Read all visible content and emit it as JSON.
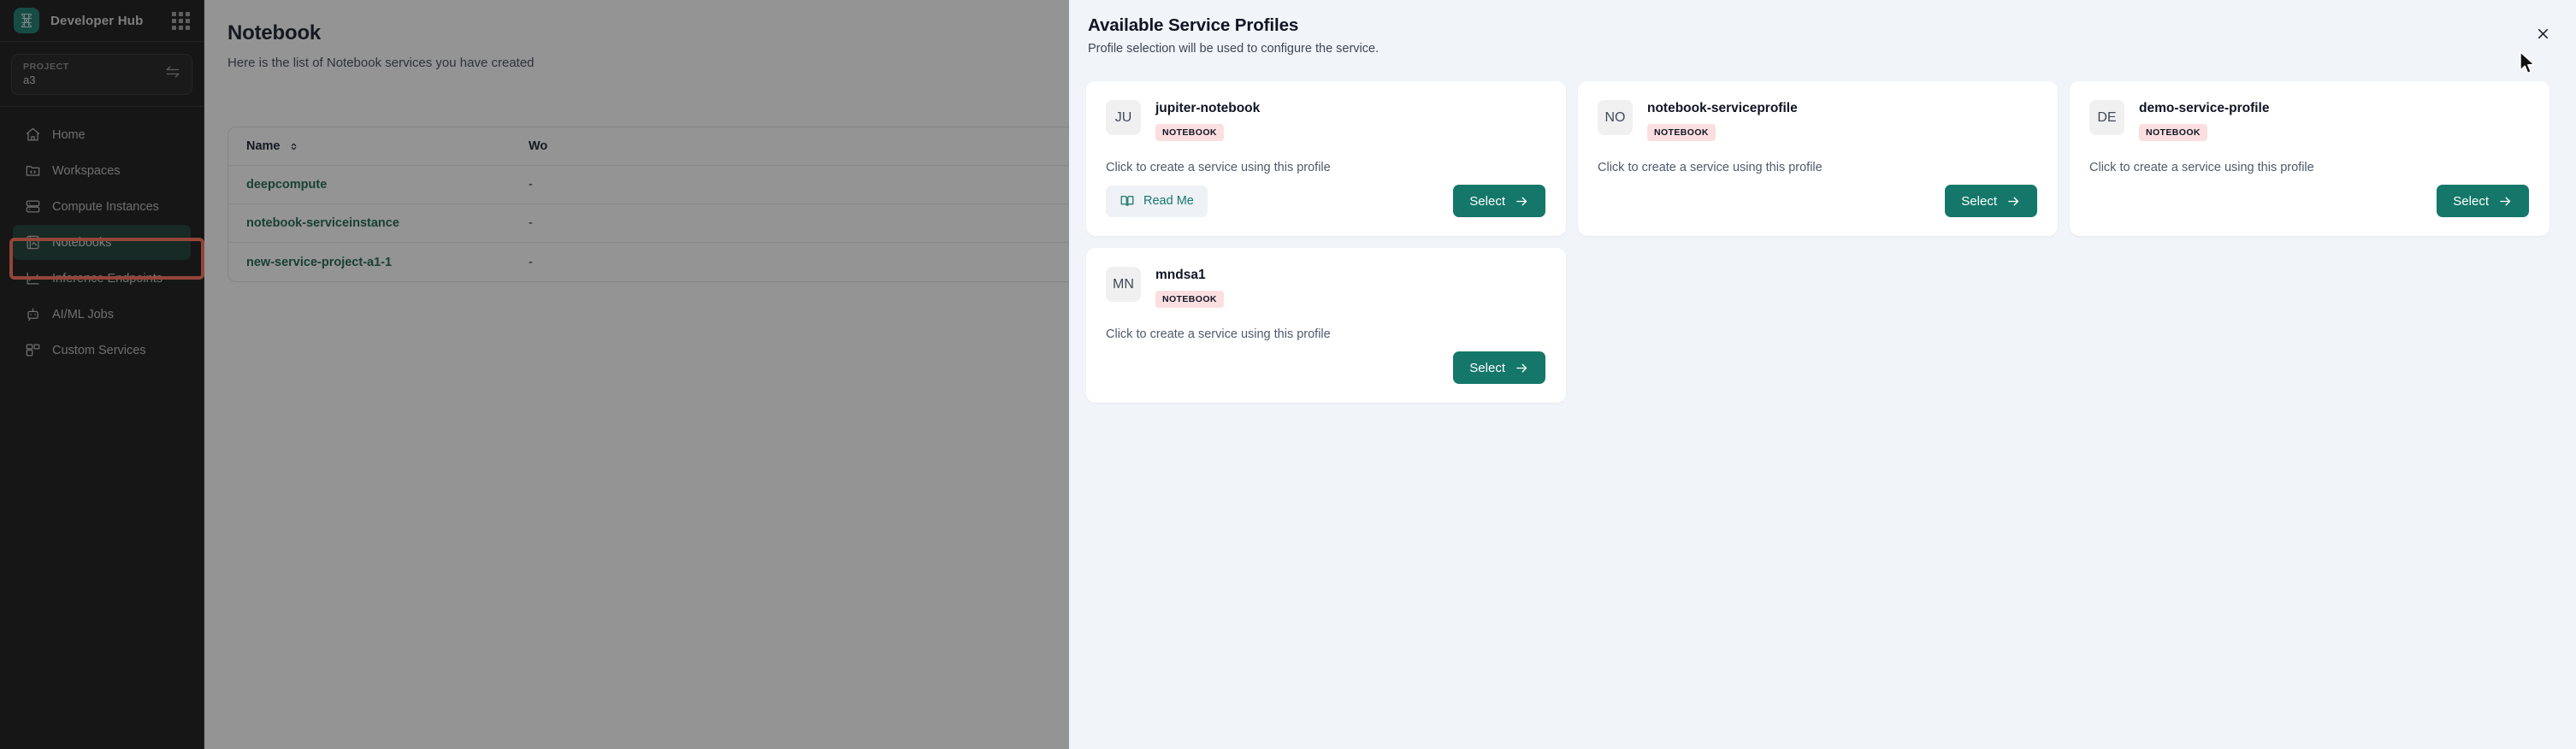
{
  "sidebar": {
    "brand": "Developer Hub",
    "apps_icon": "grid-apps-icon",
    "project": {
      "label": "PROJECT",
      "value": "a3",
      "switch_icon": "swap-arrows-icon"
    },
    "items": [
      {
        "label": "Home",
        "icon": "home-icon",
        "active": false
      },
      {
        "label": "Workspaces",
        "icon": "folder-code-icon",
        "active": false
      },
      {
        "label": "Compute Instances",
        "icon": "server-icon",
        "active": false
      },
      {
        "label": "Notebooks",
        "icon": "notebook-image-icon",
        "active": true
      },
      {
        "label": "Inference Endpoints",
        "icon": "chart-line-icon",
        "active": false
      },
      {
        "label": "AI/ML Jobs",
        "icon": "robot-icon",
        "active": false
      },
      {
        "label": "Custom Services",
        "icon": "blocks-icon",
        "active": false
      }
    ]
  },
  "main": {
    "title": "Notebook",
    "subtitle": "Here is the list of Notebook services you have created",
    "table": {
      "columns": [
        "Name",
        "Wo"
      ],
      "sort_icon": "sort-updown-icon",
      "rows": [
        {
          "name": "deepcompute",
          "wo": "-"
        },
        {
          "name": "notebook-serviceinstance",
          "wo": "-"
        },
        {
          "name": "new-service-project-a1-1",
          "wo": "-"
        }
      ]
    }
  },
  "modal": {
    "title": "Available Service Profiles",
    "subtitle": "Profile selection will be used to configure the service.",
    "close_icon": "close-x-icon",
    "cards": [
      {
        "initials": "JU",
        "name": "jupiter-notebook",
        "tag": "NOTEBOOK",
        "description": "Click to create a service using this profile",
        "readme_label": "Read Me",
        "readme_icon": "book-open-icon",
        "select_label": "Select",
        "select_arrow_icon": "arrow-right-icon",
        "has_readme": true
      },
      {
        "initials": "NO",
        "name": "notebook-serviceprofile",
        "tag": "NOTEBOOK",
        "description": "Click to create a service using this profile",
        "select_label": "Select",
        "select_arrow_icon": "arrow-right-icon",
        "has_readme": false
      },
      {
        "initials": "DE",
        "name": "demo-service-profile",
        "tag": "NOTEBOOK",
        "description": "Click to create a service using this profile",
        "select_label": "Select",
        "select_arrow_icon": "arrow-right-icon",
        "has_readme": false
      },
      {
        "initials": "MN",
        "name": "mndsa1",
        "tag": "NOTEBOOK",
        "description": "Click to create a service using this profile",
        "select_label": "Select",
        "select_arrow_icon": "arrow-right-icon",
        "has_readme": false
      }
    ]
  },
  "colors": {
    "brand_green": "#14776a",
    "sidebar_bg": "#111111",
    "active_nav_bg": "#15372f",
    "highlight_outline": "#ff6b54",
    "modal_bg": "#f1f4f9",
    "tag_bg": "#fbdfe0",
    "link_green": "#17614d"
  }
}
